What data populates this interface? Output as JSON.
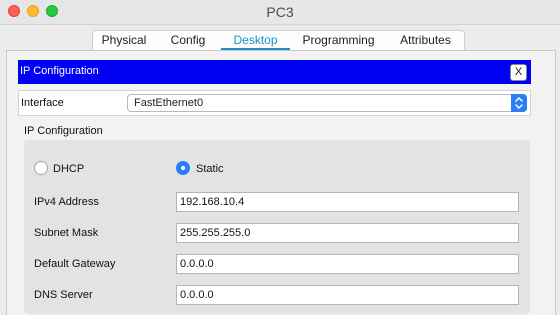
{
  "window": {
    "title": "PC3"
  },
  "tabs": [
    {
      "label": "Physical",
      "active": false
    },
    {
      "label": "Config",
      "active": false
    },
    {
      "label": "Desktop",
      "active": true
    },
    {
      "label": "Programming",
      "active": false
    },
    {
      "label": "Attributes",
      "active": false
    }
  ],
  "dialog": {
    "title": "IP Configuration",
    "close_label": "X"
  },
  "interface": {
    "label": "Interface",
    "selected": "FastEthernet0"
  },
  "ip_section": {
    "title": "IP Configuration",
    "mode": {
      "dhcp_label": "DHCP",
      "static_label": "Static",
      "selected": "Static"
    },
    "fields": {
      "ipv4": {
        "label": "IPv4 Address",
        "value": "192.168.10.4"
      },
      "subnet": {
        "label": "Subnet Mask",
        "value": "255.255.255.0"
      },
      "gateway": {
        "label": "Default Gateway",
        "value": "0.0.0.0"
      },
      "dns": {
        "label": "DNS Server",
        "value": "0.0.0.0"
      }
    }
  },
  "colors": {
    "accent": "#2c7ef8",
    "active_tab": "#1f8ecb",
    "dialog_bar": "#0000f5"
  }
}
